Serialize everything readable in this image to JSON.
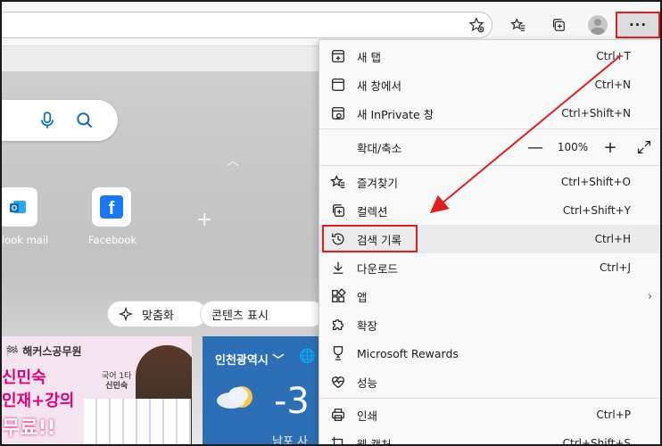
{
  "menu": {
    "items": [
      {
        "label": "새 탭",
        "shortcut": "Ctrl+T"
      },
      {
        "label": "새 창에서",
        "shortcut": "Ctrl+N"
      },
      {
        "label": "새 InPrivate 창",
        "shortcut": "Ctrl+Shift+N"
      },
      {
        "label": "확대/축소",
        "shortcut": ""
      },
      {
        "label": "즐겨찾기",
        "shortcut": "Ctrl+Shift+O"
      },
      {
        "label": "컬렉션",
        "shortcut": "Ctrl+Shift+Y"
      },
      {
        "label": "검색 기록",
        "shortcut": "Ctrl+H"
      },
      {
        "label": "다운로드",
        "shortcut": "Ctrl+J"
      },
      {
        "label": "앱",
        "shortcut": ""
      },
      {
        "label": "확장",
        "shortcut": ""
      },
      {
        "label": "Microsoft Rewards",
        "shortcut": ""
      },
      {
        "label": "성능",
        "shortcut": ""
      },
      {
        "label": "인쇄",
        "shortcut": "Ctrl+P"
      },
      {
        "label": "웹 캡처",
        "shortcut": "Ctrl+Shift+S"
      }
    ],
    "zoom_value": "100%",
    "zoom_minus": "—",
    "zoom_plus": "+"
  },
  "toolbar": {
    "more_label": "···"
  },
  "newtab": {
    "tiles": [
      {
        "label": "look mail"
      },
      {
        "label": "Facebook"
      }
    ],
    "pills": {
      "customize": "맞춤화",
      "content": "콘텐츠 표시"
    },
    "ad": {
      "brand": "해커스공무원",
      "line1": "신민숙",
      "line2": "인재+강의",
      "line3": "무료!!",
      "badge_top": "국어 1타",
      "badge_name": "신민숙"
    },
    "weather": {
      "city": "인천광역시",
      "temp": "-3",
      "sub": "남포 사"
    }
  },
  "colors": {
    "highlight_red": "#e0201e",
    "accent_blue": "#0f6cbd",
    "facebook_blue": "#1877f2"
  }
}
